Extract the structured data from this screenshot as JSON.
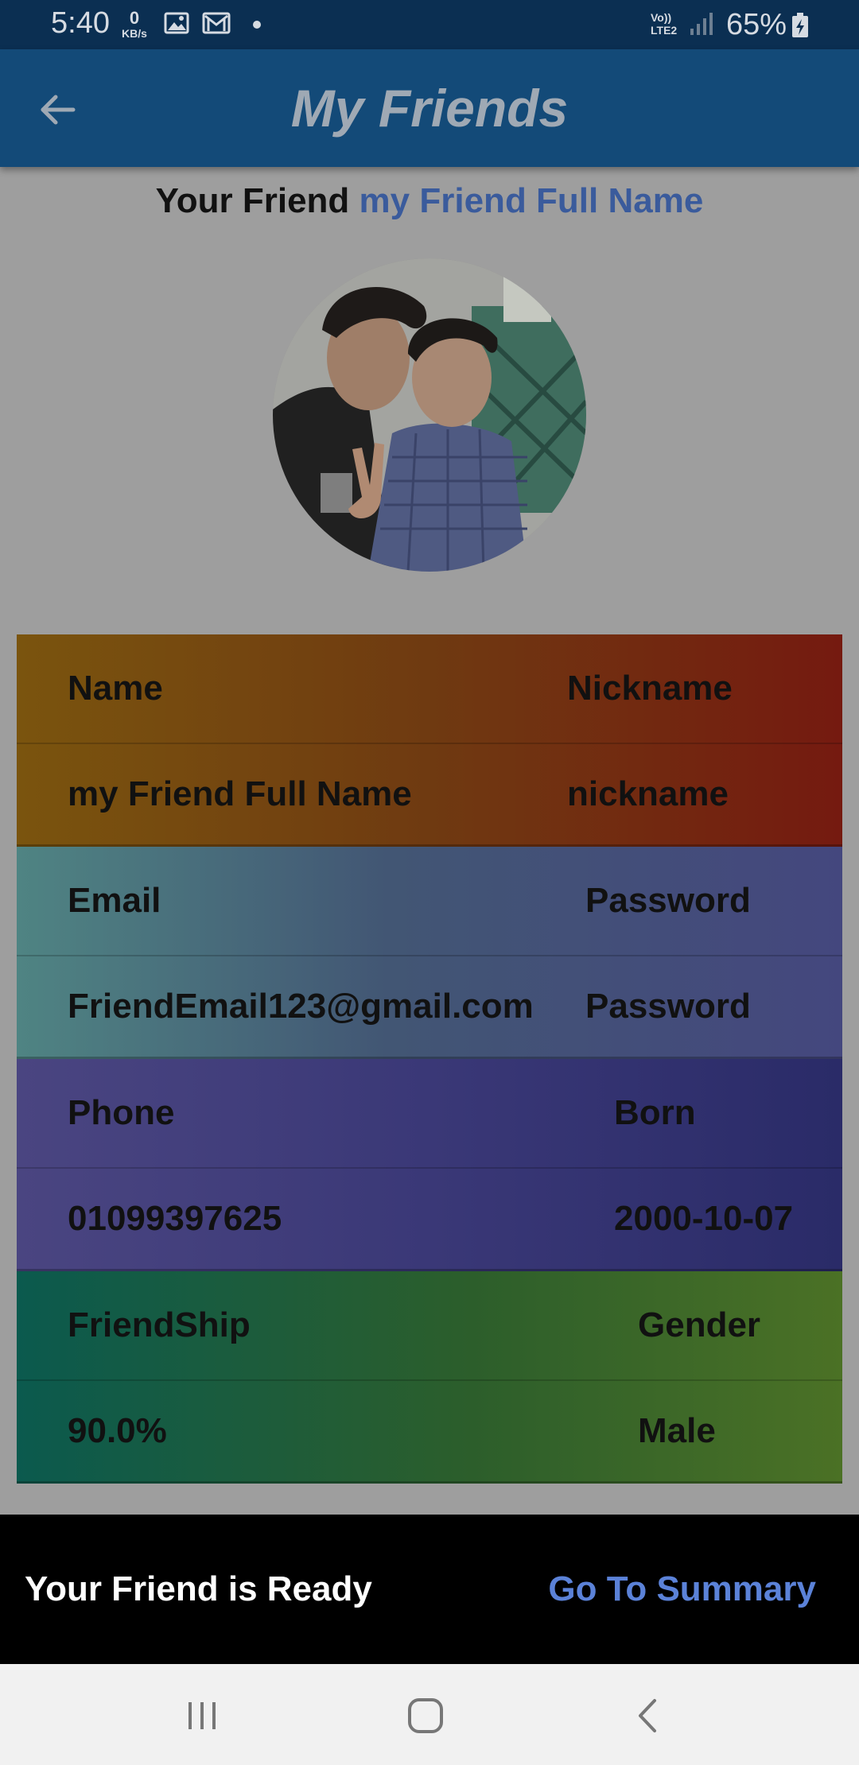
{
  "status_bar": {
    "time": "5:40",
    "network_speed_value": "0",
    "network_speed_unit": "KB/s",
    "icons": [
      "image-icon",
      "gmail-icon",
      "notification-dot-icon",
      "volte-icon",
      "signal-icon",
      "battery-charging-icon"
    ],
    "lte_top": "Vo))",
    "lte_bottom": "LTE2",
    "battery": "65%"
  },
  "app_bar": {
    "title": "My Friends",
    "back_icon": "arrow-left-icon"
  },
  "friend_header": {
    "label": "Your Friend",
    "name": "my Friend Full Name"
  },
  "avatar": {
    "icon": "friend-photo"
  },
  "table": {
    "groups": [
      {
        "headers": [
          "Name",
          "Nickname"
        ],
        "values": [
          "my Friend Full Name",
          "nickname"
        ]
      },
      {
        "headers": [
          "Email",
          "Password"
        ],
        "values": [
          "FriendEmail123@gmail.com",
          "Password"
        ]
      },
      {
        "headers": [
          "Phone",
          "Born"
        ],
        "values": [
          "01099397625",
          "2000-10-07"
        ]
      },
      {
        "headers": [
          "FriendShip",
          "Gender"
        ],
        "values": [
          "90.0%",
          "Male"
        ]
      }
    ]
  },
  "snackbar": {
    "message": "Your Friend is Ready",
    "action": "Go To Summary"
  },
  "nav_bar": {
    "icons": [
      "recent-apps-icon",
      "home-icon",
      "back-icon"
    ]
  }
}
